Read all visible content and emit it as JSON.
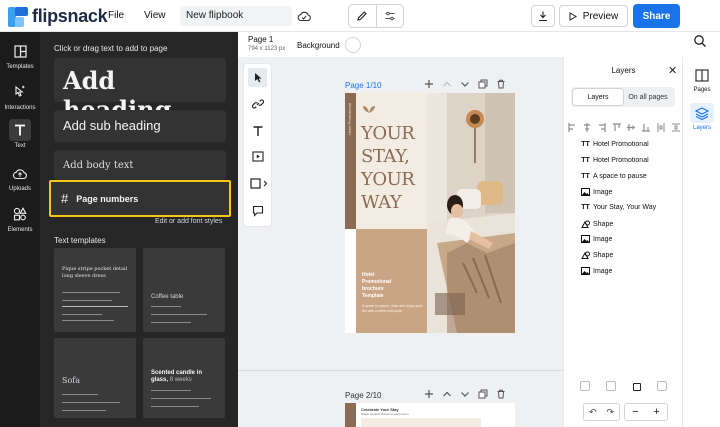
{
  "app": {
    "logo_text": "flipsnack",
    "menu": [
      "File",
      "View"
    ],
    "doc_name": "New flipbook",
    "preview_label": "Preview",
    "share_label": "Share"
  },
  "leftnav": [
    {
      "id": "templates",
      "label": "Templates",
      "icon": "templates-icon"
    },
    {
      "id": "interactions",
      "label": "Interactions",
      "icon": "interactions-icon"
    },
    {
      "id": "text",
      "label": "Text",
      "icon": "text-icon",
      "active": true
    },
    {
      "id": "uploads",
      "label": "Uploads",
      "icon": "upload-icon"
    },
    {
      "id": "elements",
      "label": "Elements",
      "icon": "elements-icon"
    }
  ],
  "textpanel": {
    "hint": "Click or drag text to add to page",
    "add_heading": "Add heading",
    "add_sub_heading": "Add sub heading",
    "add_body_text": "Add body text",
    "page_numbers": "Page numbers",
    "edit_font_styles": "Edit or add font styles",
    "text_templates_label": "Text templates",
    "templates": [
      {
        "text": "Pique stripe pocket detail long sleeve dress"
      },
      {
        "text": "Coffee table"
      },
      {
        "text": "Sofa"
      },
      {
        "text": "Scented candle in glass,",
        "suffix": "8 weeks"
      }
    ]
  },
  "canvas": {
    "page_label": "Page 1",
    "page_size": "794 x 1123 px",
    "background_label": "Background",
    "page1_label": "Page 1/10",
    "page2_label": "Page 2/10",
    "page1": {
      "strip_text": "Hotel Promotional",
      "title": "YOUR\nSTAY,\nYOUR\nWAY",
      "subtitle": "Hotel\nPromotional\nbrochure\nTemplate",
      "body": "A space to pause, relax and enjoy your trip with comfort and style."
    },
    "page2": {
      "title": "Celebrate Your Stay",
      "sub": "Share comfort stories in every room"
    }
  },
  "layers": {
    "title": "Layers",
    "tabs": [
      "Layers",
      "On all pages"
    ],
    "items": [
      {
        "type": "text",
        "label": "Hotel Promotional"
      },
      {
        "type": "text",
        "label": "Hotel Promotional"
      },
      {
        "type": "text",
        "label": "A space to pause"
      },
      {
        "type": "image",
        "label": "Image"
      },
      {
        "type": "text",
        "label": "Your Stay, Your Way"
      },
      {
        "type": "shape",
        "label": "Shape"
      },
      {
        "type": "image",
        "label": "Image"
      },
      {
        "type": "shape",
        "label": "Shape"
      },
      {
        "type": "image",
        "label": "Image"
      }
    ]
  },
  "rail": [
    {
      "id": "pages",
      "label": "Pages",
      "icon": "pages-icon"
    },
    {
      "id": "layers",
      "label": "Layers",
      "icon": "layers-icon",
      "active": true
    }
  ],
  "colors": {
    "accent": "#1a73e8",
    "highlight": "#f5c518",
    "brown": "#8b6b54",
    "tan": "#c9a586"
  }
}
